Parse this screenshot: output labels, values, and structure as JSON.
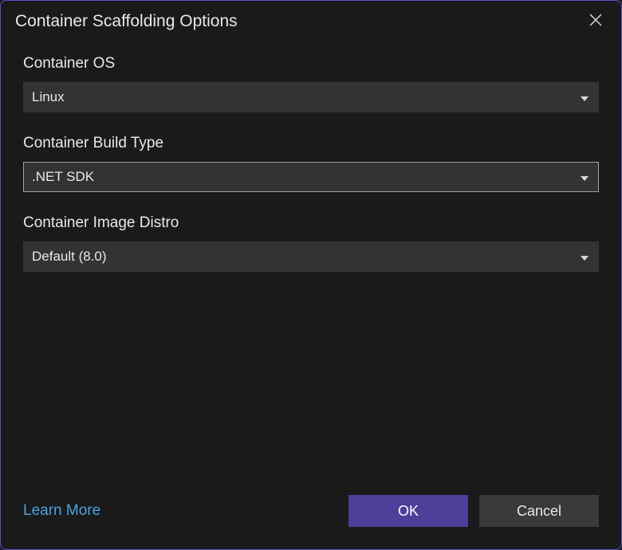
{
  "dialog": {
    "title": "Container Scaffolding Options"
  },
  "fields": {
    "os": {
      "label": "Container OS",
      "value": "Linux"
    },
    "buildType": {
      "label": "Container Build Type",
      "value": ".NET SDK"
    },
    "imageDistro": {
      "label": "Container Image Distro",
      "value": "Default (8.0)"
    }
  },
  "footer": {
    "learnMore": "Learn More",
    "ok": "OK",
    "cancel": "Cancel"
  }
}
